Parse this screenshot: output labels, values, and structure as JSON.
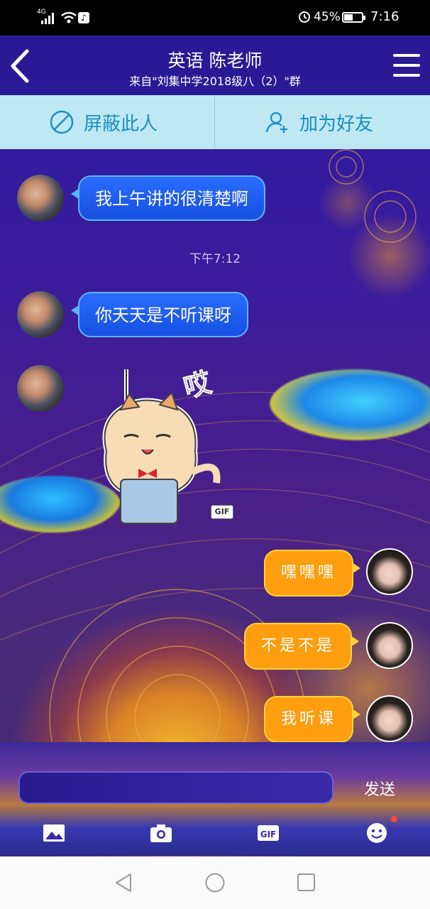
{
  "status_bar": {
    "network": "4G",
    "battery_percent": "45%",
    "time": "7:16",
    "icons": [
      "signal-icon",
      "wifi-icon",
      "tiktok-icon",
      "alarm-icon",
      "battery-icon"
    ]
  },
  "header": {
    "title": "英语 陈老师",
    "subtitle": "来自\"刘集中学2018级八（2）\"群",
    "back_icon": "back-arrow-icon",
    "menu_icon": "menu-icon"
  },
  "actions": {
    "block_label": "屏蔽此人",
    "add_friend_label": "加为好友"
  },
  "chat": {
    "timestamp": "下午7:12",
    "incoming": [
      {
        "text": "我上午讲的很清楚啊"
      },
      {
        "text": "你天天是不听课呀"
      }
    ],
    "sticker": {
      "badge": "GIF",
      "caption": "哎"
    },
    "outgoing": [
      {
        "text": "嘿嘿嘿"
      },
      {
        "text": "不是不是"
      },
      {
        "text": "我听课"
      }
    ]
  },
  "input": {
    "value": "",
    "send_label": "发送"
  },
  "toolbar": {
    "gif_label": "GIF",
    "items": [
      "image-icon",
      "camera-icon",
      "gif-icon",
      "emoji-icon"
    ]
  },
  "colors": {
    "incoming_bubble": "#1650e0",
    "outgoing_bubble": "#ff9f10",
    "action_bar": "#bfe8f5",
    "action_text": "#1a8fc0"
  }
}
